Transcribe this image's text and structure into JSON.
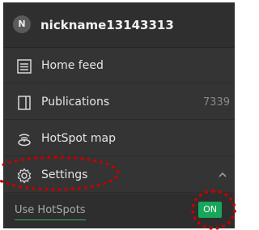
{
  "header": {
    "avatar_initial": "N",
    "username": "nickname13143313"
  },
  "menu": {
    "home_feed": {
      "label": "Home feed",
      "icon": "news-feed-icon"
    },
    "publications": {
      "label": "Publications",
      "count": "7339",
      "icon": "document-icon"
    },
    "hotspot_map": {
      "label": "HotSpot map",
      "icon": "hotspot-map-icon"
    },
    "settings": {
      "label": "Settings",
      "icon": "gear-icon",
      "expanded": true
    }
  },
  "settings_panel": {
    "use_hotspots_label": "Use HotSpots",
    "toggle_state": "ON"
  },
  "colors": {
    "panel_bg": "#343434",
    "accent_green": "#18a65a",
    "annotation_red": "#c40000"
  }
}
